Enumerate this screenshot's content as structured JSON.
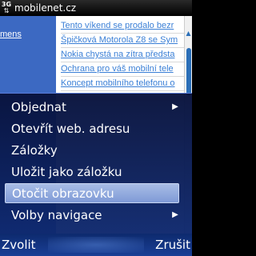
{
  "statusbar": {
    "network": "3G",
    "site_title": "mobilenet.cz"
  },
  "page": {
    "left_link": "mens",
    "news": [
      "Tento víkend se prodalo bezr",
      "Špičková Motorola Z8 se Sym",
      "Nokia chystá na zítra předsta",
      "Ochrana pro váš mobilní tele",
      "Koncept mobilního telefonu o"
    ]
  },
  "menu": {
    "items": [
      {
        "label": "Objednat",
        "has_submenu": true
      },
      {
        "label": "Otevřít web. adresu",
        "has_submenu": false
      },
      {
        "label": "Záložky",
        "has_submenu": false
      },
      {
        "label": "Uložit jako záložku",
        "has_submenu": false
      },
      {
        "label": "Otočit obrazovku",
        "has_submenu": false,
        "selected": true
      },
      {
        "label": "Volby navigace",
        "has_submenu": true
      }
    ]
  },
  "softkeys": {
    "left": "Zvolit",
    "right": "Zrušit"
  },
  "colors": {
    "menu_bg": "#0e2a70",
    "selection": "#9fb5e3",
    "link": "#3a7fd6",
    "sidebar": "#3c69c2"
  }
}
